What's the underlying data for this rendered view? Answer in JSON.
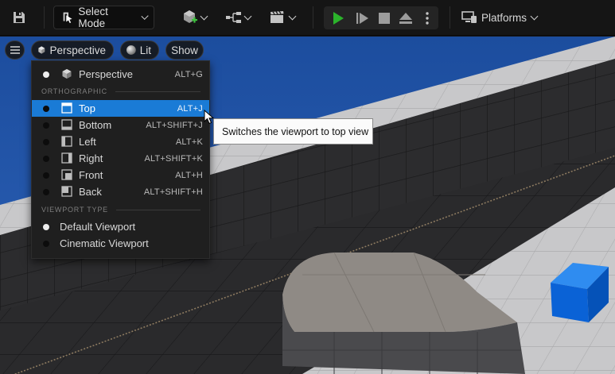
{
  "toolbar": {
    "select_mode_label": "Select Mode",
    "platforms_label": "Platforms",
    "icons": [
      "save-icon",
      "select-mode-icon",
      "add-actor-icon",
      "blueprint-icon",
      "sequencer-icon",
      "play-icon",
      "step-icon",
      "stop-icon",
      "eject-icon",
      "more-options-icon",
      "platforms-icon"
    ],
    "play_color": "#2bb32b"
  },
  "viewport_toolbar": {
    "perspective_label": "Perspective",
    "lit_label": "Lit",
    "show_label": "Show"
  },
  "menu": {
    "top_item": {
      "label": "Perspective",
      "shortcut": "ALT+G"
    },
    "sections": [
      {
        "title": "ORTHOGRAPHIC",
        "items": [
          {
            "label": "Top",
            "shortcut": "ALT+J",
            "active": true
          },
          {
            "label": "Bottom",
            "shortcut": "ALT+SHIFT+J"
          },
          {
            "label": "Left",
            "shortcut": "ALT+K"
          },
          {
            "label": "Right",
            "shortcut": "ALT+SHIFT+K"
          },
          {
            "label": "Front",
            "shortcut": "ALT+H"
          },
          {
            "label": "Back",
            "shortcut": "ALT+SHIFT+H"
          }
        ]
      },
      {
        "title": "VIEWPORT TYPE",
        "items": [
          {
            "label": "Default Viewport"
          },
          {
            "label": "Cinematic Viewport"
          }
        ]
      }
    ],
    "highlight_color": "#1a7bd6"
  },
  "tooltip": {
    "text": "Switches the viewport to top view"
  }
}
